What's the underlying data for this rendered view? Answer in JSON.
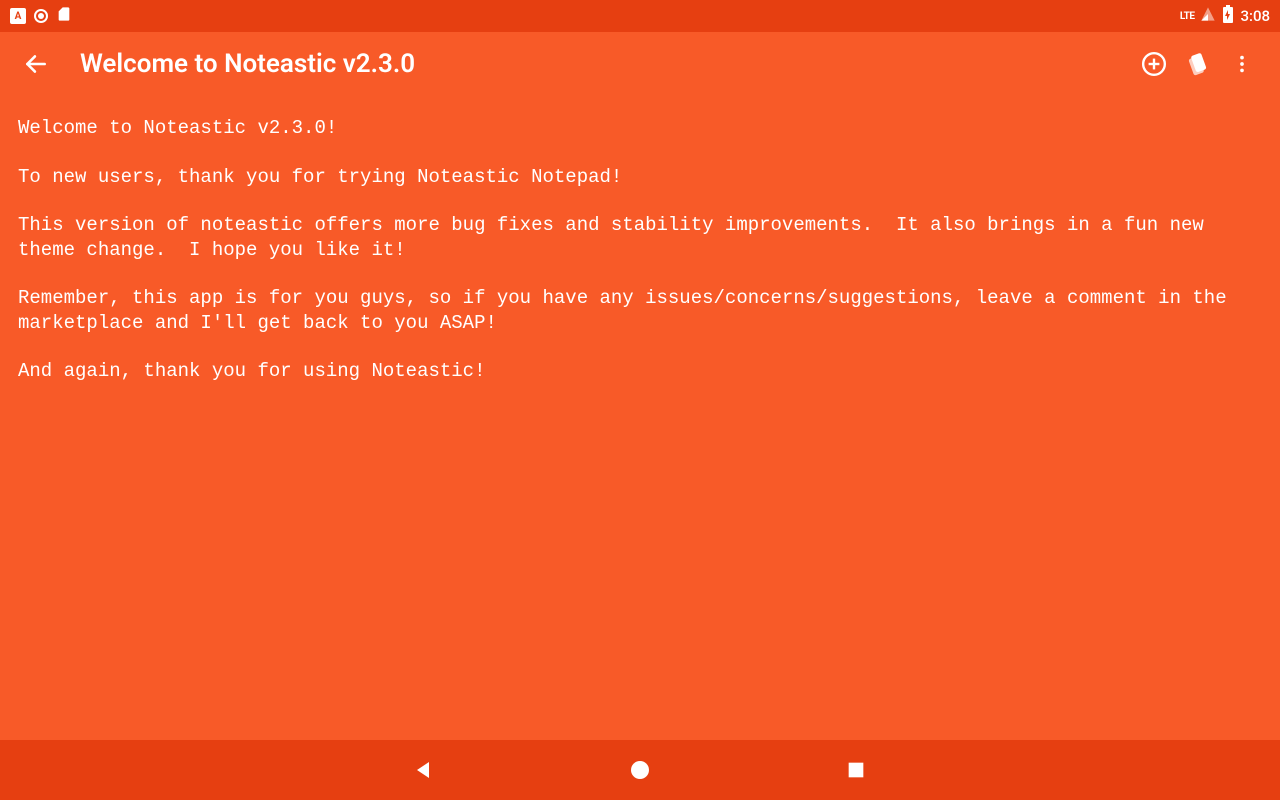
{
  "status": {
    "left_badge": "A",
    "lte": "LTE",
    "time": "3:08"
  },
  "appbar": {
    "title": "Welcome to Noteastic v2.3.0"
  },
  "note": {
    "body": "Welcome to Noteastic v2.3.0!\n\nTo new users, thank you for trying Noteastic Notepad!\n\nThis version of noteastic offers more bug fixes and stability improvements.  It also brings in a fun new theme change.  I hope you like it!\n\nRemember, this app is for you guys, so if you have any issues/concerns/suggestions, leave a comment in the marketplace and I'll get back to you ASAP!\n\nAnd again, thank you for using Noteastic!"
  }
}
